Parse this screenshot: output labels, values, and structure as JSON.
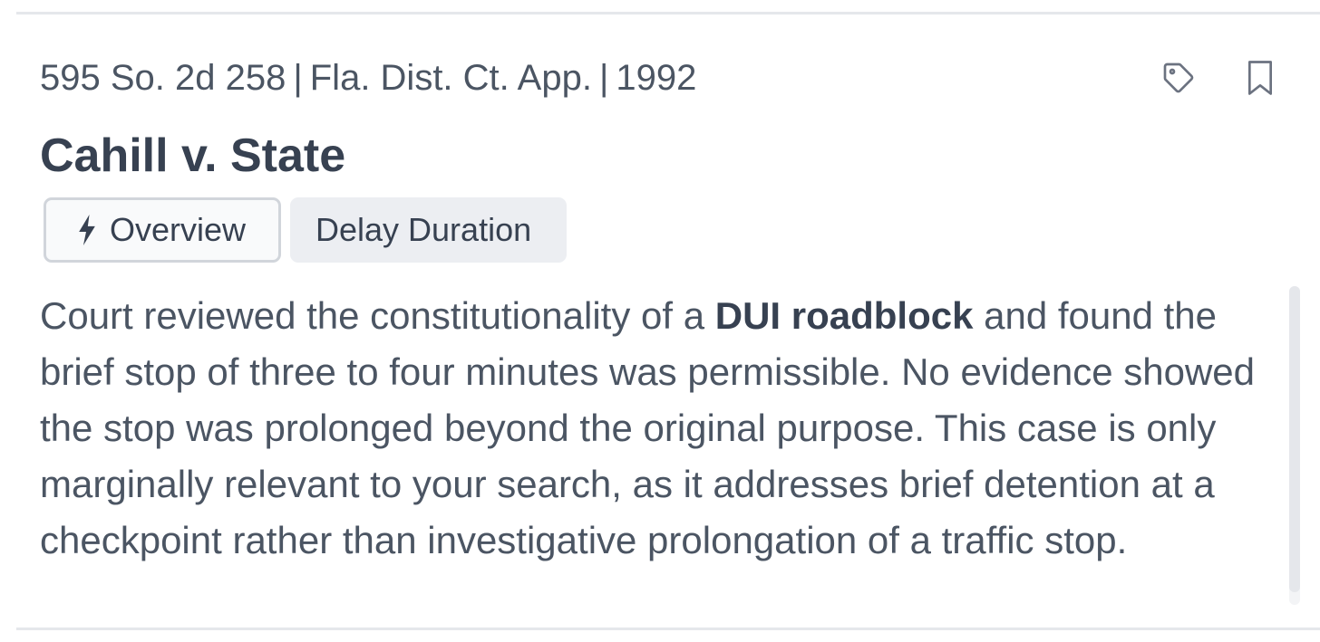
{
  "case": {
    "citation": "595 So. 2d 258",
    "court": "Fla. Dist. Ct. App.",
    "year": "1992",
    "separator": "|",
    "title": "Cahill v. State"
  },
  "actions": {
    "tag_icon": "tag-icon",
    "bookmark_icon": "bookmark-icon"
  },
  "tabs": [
    {
      "label": "Overview",
      "icon": "bolt-icon",
      "active": true
    },
    {
      "label": "Delay Duration",
      "active": false
    }
  ],
  "summary": {
    "before": "Court reviewed the constitutionality of a ",
    "highlight": "DUI roadblock",
    "after": " and found the brief stop of three to four minutes was permissible. No evidence showed the stop was prolonged beyond the original purpose. This case is only marginally relevant to your search, as it addresses brief detention at a checkpoint rather than investigative prolongation of a traffic stop."
  },
  "colors": {
    "title": "#374151",
    "body_text": "#4b5563",
    "divider": "#e5e7eb",
    "tab_inactive_bg": "#eceef2"
  }
}
